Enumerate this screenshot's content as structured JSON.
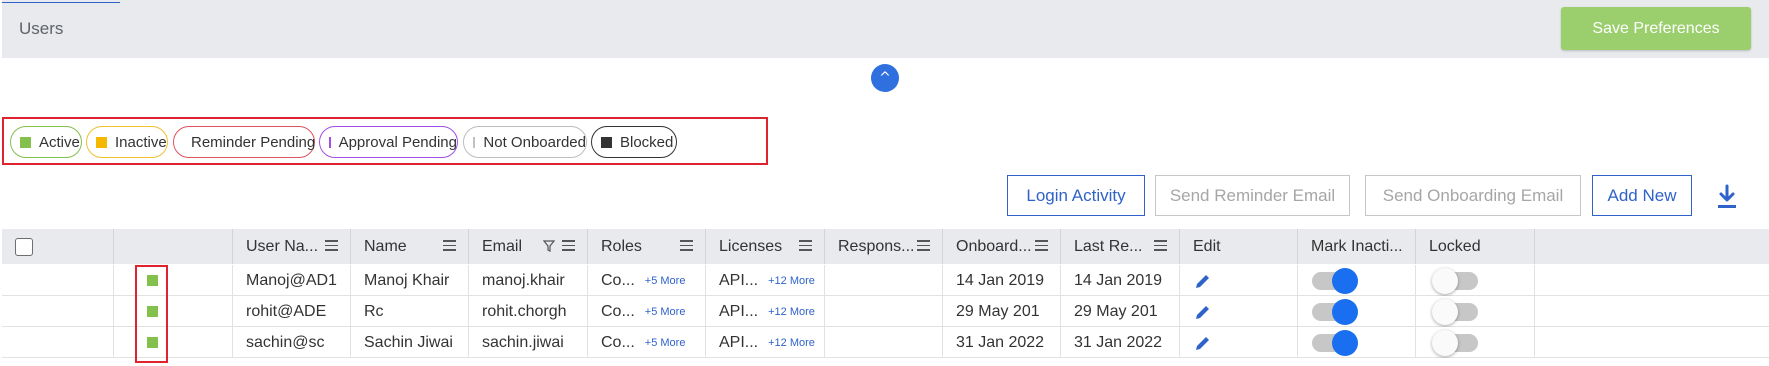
{
  "header": {
    "title": "Users",
    "save_label": "Save Preferences"
  },
  "collapse_glyph": "^",
  "legend": [
    {
      "label": "Active",
      "color": "#83c04c",
      "border": "#83c04c"
    },
    {
      "label": "Inactive",
      "color": "#f5b800",
      "border": "#f0c030"
    },
    {
      "label": "Reminder Pending",
      "color": "#f26a4f",
      "border": "#e0545d"
    },
    {
      "label": "Approval Pending",
      "color": "#a050e8",
      "border": "#a050e8"
    },
    {
      "label": "Not Onboarded",
      "color": "#c0c0c0",
      "border": "#bdbdbd"
    },
    {
      "label": "Blocked",
      "color": "#333333",
      "border": "#333333"
    }
  ],
  "actions": {
    "login_activity": "Login Activity",
    "send_reminder": "Send Reminder Email",
    "send_onboarding": "Send Onboarding Email",
    "add_new": "Add New"
  },
  "columns": {
    "user_name": "User Na...",
    "name": "Name",
    "email": "Email",
    "roles": "Roles",
    "licenses": "Licenses",
    "response": "Respons...",
    "onboarded": "Onboard...",
    "last_reminder": "Last Re...",
    "edit": "Edit",
    "mark_inactive": "Mark Inacti...",
    "locked": "Locked"
  },
  "rows": [
    {
      "user_name": "Manoj@AD1",
      "name": "Manoj Khair",
      "email": "manoj.khair",
      "roles": "Co...",
      "roles_more": "+5 More",
      "licenses": "API...",
      "licenses_more": "+12 More",
      "response": "",
      "onboarded": "14 Jan 2019",
      "last_reminder": "14 Jan 2019",
      "mark_inactive": true,
      "locked": false
    },
    {
      "user_name": "rohit@ADE",
      "name": "Rc",
      "email": "rohit.chorgh",
      "roles": "Co...",
      "roles_more": "+5 More",
      "licenses": "API...",
      "licenses_more": "+12 More",
      "response": "",
      "onboarded": "29 May 201",
      "last_reminder": "29 May 201",
      "mark_inactive": true,
      "locked": false
    },
    {
      "user_name": "sachin@sc",
      "name": "Sachin Jiwai",
      "email": "sachin.jiwai",
      "roles": "Co...",
      "roles_more": "+5 More",
      "licenses": "API...",
      "licenses_more": "+12 More",
      "response": "",
      "onboarded": "31 Jan 2022",
      "last_reminder": "31 Jan 2022",
      "mark_inactive": true,
      "locked": false
    }
  ]
}
